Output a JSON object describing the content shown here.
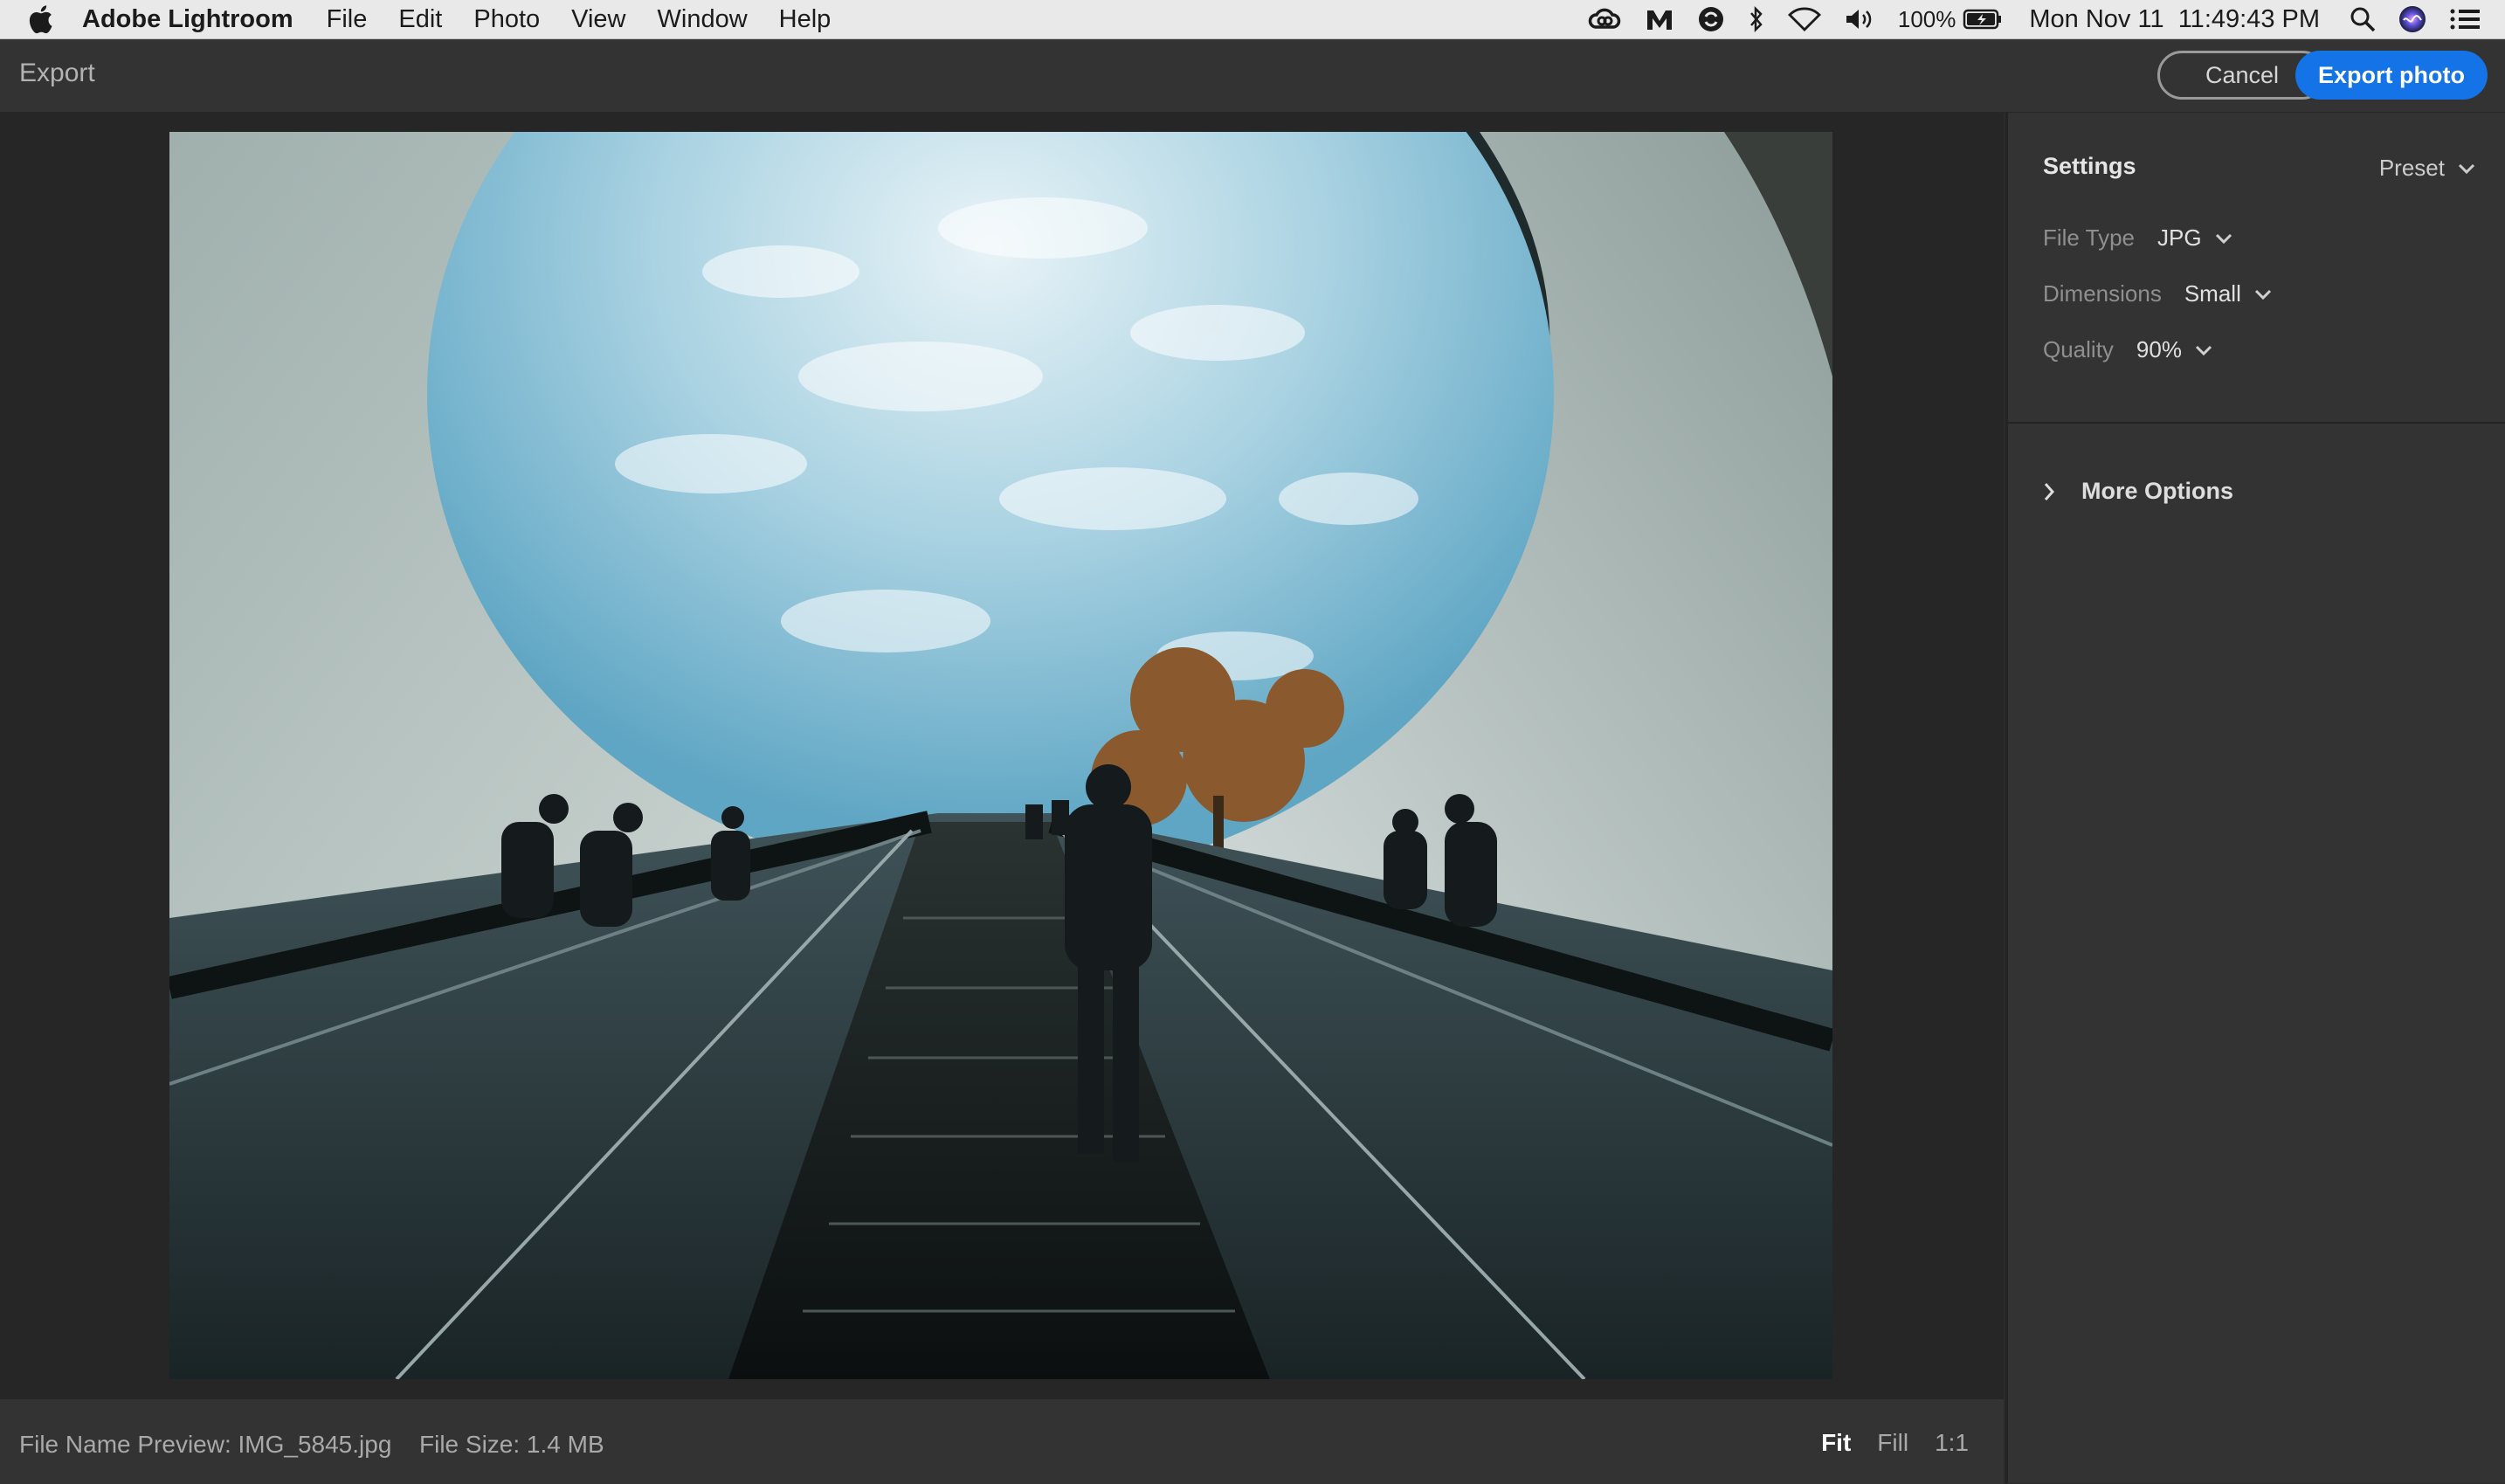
{
  "menubar": {
    "app_name": "Adobe Lightroom",
    "menus": [
      "File",
      "Edit",
      "Photo",
      "View",
      "Window",
      "Help"
    ],
    "battery": "100%",
    "datetime": "Mon Nov 11  11:49:43 PM"
  },
  "window": {
    "title": "Export",
    "cancel_label": "Cancel",
    "export_label": "Export photo",
    "accent_color": "#1473e6"
  },
  "settings": {
    "title": "Settings",
    "preset_label": "Preset",
    "file_type": {
      "label": "File Type",
      "value": "JPG"
    },
    "dimensions": {
      "label": "Dimensions",
      "value": "Small"
    },
    "quality": {
      "label": "Quality",
      "value": "90%"
    },
    "more_options": "More Options"
  },
  "footer": {
    "file_name": "File Name Preview: IMG_5845.jpg",
    "file_size": "File Size: 1.4 MB",
    "zoom": {
      "fit": "Fit",
      "fill": "Fill",
      "one_to_one": "1:1",
      "active": "Fit"
    }
  },
  "icons": {
    "apple": "apple-icon",
    "creative_cloud": "creative-cloud-icon",
    "malwarebytes": "m-icon",
    "sync": "sync-icon",
    "bluetooth": "bluetooth-icon",
    "wifi": "wifi-icon",
    "volume": "volume-icon",
    "battery": "battery-icon",
    "search": "search-icon",
    "siri": "siri-icon",
    "notification_center": "list-icon"
  }
}
